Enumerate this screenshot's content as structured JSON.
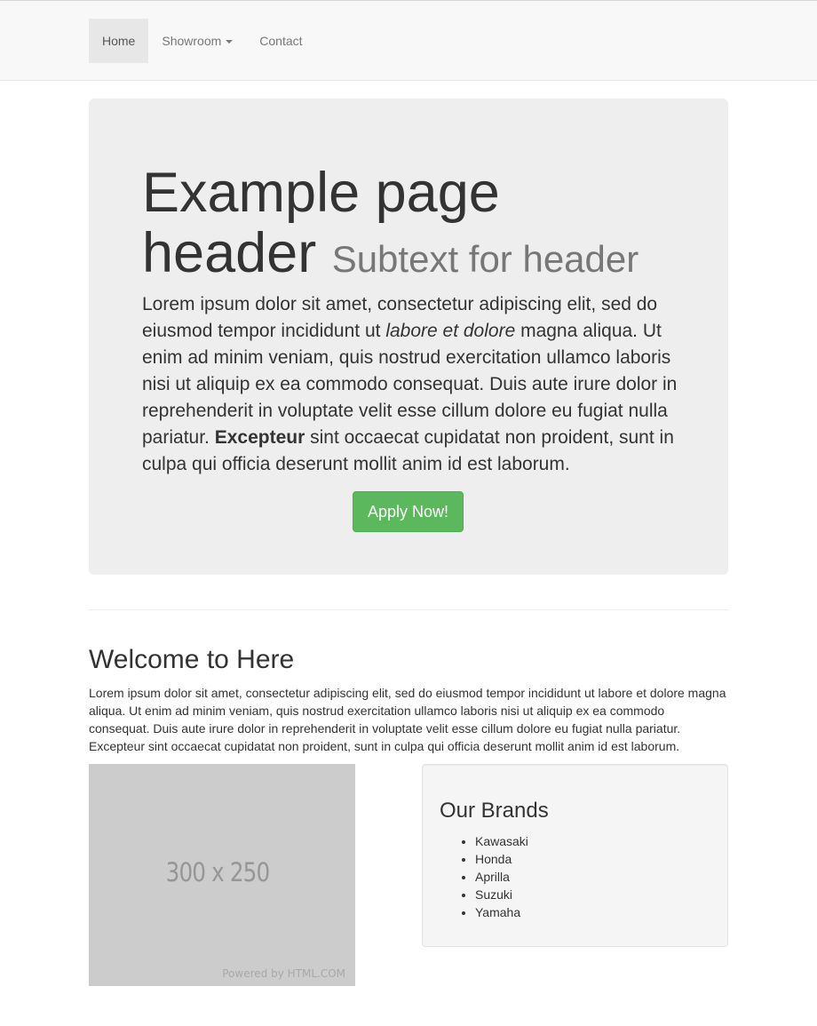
{
  "nav": {
    "items": [
      {
        "label": "Home",
        "active": true
      },
      {
        "label": "Showroom",
        "dropdown": true
      },
      {
        "label": "Contact"
      }
    ]
  },
  "hero": {
    "title": "Example page header",
    "subtext": "Subtext for header",
    "paragraph": {
      "part1": "Lorem ipsum dolor sit amet, consectetur adipiscing elit, sed do eiusmod tempor incididunt ut ",
      "italic": "labore et dolore",
      "part2": " magna aliqua. Ut enim ad minim veniam, quis nostrud exercitation ullamco laboris nisi ut aliquip ex ea commodo consequat. Duis aute irure dolor in reprehenderit in voluptate velit esse cillum dolore eu fugiat nulla pariatur. ",
      "bold": "Excepteur",
      "part3": " sint occaecat cupidatat non proident, sunt in culpa qui officia deserunt mollit anim id est laborum."
    },
    "button_label": "Apply Now!",
    "button_color": "#5cb85c"
  },
  "welcome": {
    "title": "Welcome to Here",
    "text": "Lorem ipsum dolor sit amet, consectetur adipiscing elit, sed do eiusmod tempor incididunt ut labore et dolore magna aliqua. Ut enim ad minim veniam, quis nostrud exercitation ullamco laboris nisi ut aliquip ex ea commodo consequat. Duis aute irure dolor in reprehenderit in voluptate velit esse cillum dolore eu fugiat nulla pariatur. Excepteur sint occaecat cupidatat non proident, sunt in culpa qui officia deserunt mollit anim id est laborum."
  },
  "placeholder_image": {
    "size_text": "300 x 250",
    "powered_text": "Powered by HTML.COM"
  },
  "brands": {
    "title": "Our Brands",
    "items": [
      "Kawasaki",
      "Honda",
      "Aprilla",
      "Suzuki",
      "Yamaha"
    ]
  }
}
